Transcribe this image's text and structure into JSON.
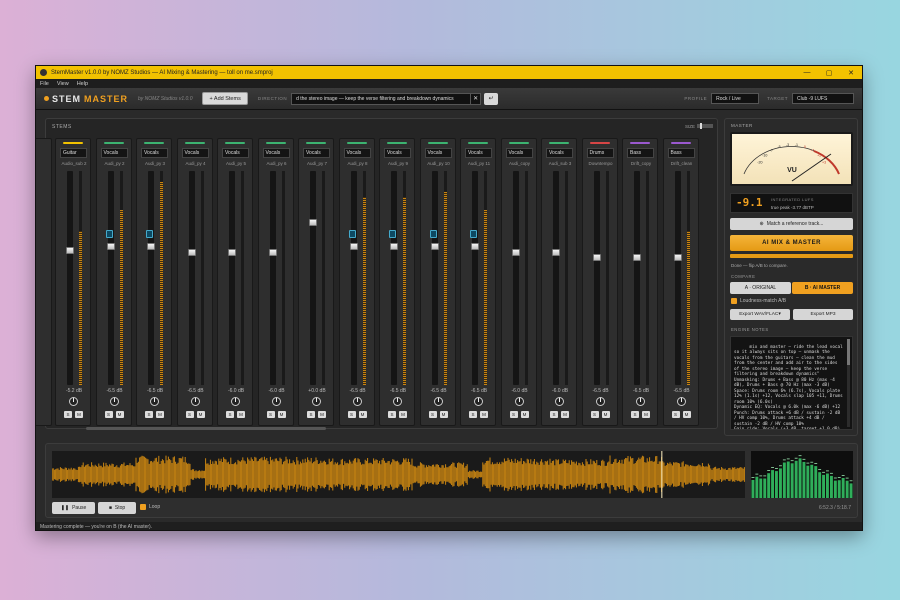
{
  "window": {
    "title": "StemMaster v1.0.0 by NOMZ Studios — AI Mixing & Mastering — toll on me.smproj",
    "controls": {
      "minimize": "—",
      "maximize": "▢",
      "close": "✕"
    }
  },
  "menu": [
    "File",
    "View",
    "Help"
  ],
  "toolbar": {
    "logo_main": "STEM",
    "logo_accent": "MASTER",
    "byline": "by NOMZ Studios   v1.0.0",
    "add_stems": "+ Add Stems",
    "direction_label": "DIRECTION",
    "direction_value": "d the stereo image — keep the verse filtering and breakdown dynamics",
    "direction_clear": "✕",
    "direction_enter": "↵",
    "profile_label": "PROFILE",
    "profile_value": "Rock / Live",
    "target_label": "TARGET",
    "target_value": "Club -9 LUFS"
  },
  "stems": {
    "title": "STEMS",
    "size_label": "SIZE",
    "channels": [
      {
        "type": "Guitar",
        "name": "Audio_sub 2",
        "color": "#f2c200",
        "db": "-5.2 dB",
        "level": 0.72,
        "fader": 0.63,
        "auto": false
      },
      {
        "type": "Vocals",
        "name": "Audi_py 2",
        "color": "#3cb371",
        "db": "-6.5 dB",
        "level": 0.82,
        "fader": 0.65,
        "auto": true
      },
      {
        "type": "Vocals",
        "name": "Audi_py 3",
        "color": "#3cb371",
        "db": "-6.5 dB",
        "level": 0.95,
        "fader": 0.65,
        "auto": true
      },
      {
        "type": "Vocals",
        "name": "Audi_py 4",
        "color": "#3cb371",
        "db": "-6.5 dB",
        "level": 0.0,
        "fader": 0.62,
        "auto": false
      },
      {
        "type": "Vocals",
        "name": "Audi_py 5",
        "color": "#3cb371",
        "db": "-6.0 dB",
        "level": 0.0,
        "fader": 0.62,
        "auto": false
      },
      {
        "type": "Vocals",
        "name": "Audi_py 6",
        "color": "#3cb371",
        "db": "-6.0 dB",
        "level": 0.0,
        "fader": 0.62,
        "auto": false
      },
      {
        "type": "Vocals",
        "name": "Audi_py 7",
        "color": "#3cb371",
        "db": "+0.0 dB",
        "level": 0.0,
        "fader": 0.76,
        "auto": false
      },
      {
        "type": "Vocals",
        "name": "Audi_py 8",
        "color": "#3cb371",
        "db": "-6.5 dB",
        "level": 0.88,
        "fader": 0.65,
        "auto": true
      },
      {
        "type": "Vocals",
        "name": "Audi_py 9",
        "color": "#3cb371",
        "db": "-6.5 dB",
        "level": 0.88,
        "fader": 0.65,
        "auto": true
      },
      {
        "type": "Vocals",
        "name": "Audi_py 10",
        "color": "#3cb371",
        "db": "-6.5 dB",
        "level": 0.9,
        "fader": 0.65,
        "auto": true
      },
      {
        "type": "Vocals",
        "name": "Audi_py 11",
        "color": "#3cb371",
        "db": "-6.5 dB",
        "level": 0.82,
        "fader": 0.65,
        "auto": true
      },
      {
        "type": "Vocals",
        "name": "Audi_copy",
        "color": "#3cb371",
        "db": "-6.0 dB",
        "level": 0.0,
        "fader": 0.62,
        "auto": false
      },
      {
        "type": "Vocals",
        "name": "Audi_sub 3",
        "color": "#3cb371",
        "db": "-6.0 dB",
        "level": 0.0,
        "fader": 0.62,
        "auto": false
      },
      {
        "type": "Drums",
        "name": "Downtempo",
        "color": "#d64545",
        "db": "-6.5 dB",
        "level": 0.0,
        "fader": 0.6,
        "auto": false
      },
      {
        "type": "Bass",
        "name": "Drift_copy",
        "color": "#9b59d0",
        "db": "-6.5 dB",
        "level": 0.0,
        "fader": 0.6,
        "auto": false
      },
      {
        "type": "Bass",
        "name": "Drift_clean",
        "color": "#9b59d0",
        "db": "-6.5 dB",
        "level": 0.72,
        "fader": 0.6,
        "auto": false
      }
    ],
    "solo_label": "S",
    "mute_label": "M"
  },
  "master": {
    "title": "MASTER",
    "vu_label": "VU",
    "vu_scale": [
      "-20",
      "-10",
      "-7",
      "-5",
      "-3",
      "-1",
      "0",
      "+1",
      "+2",
      "+3"
    ],
    "lufs_value": "-9.1",
    "lufs_label": "INTEGRATED LUFS",
    "lufs_sub": "true peak -3.77 dBTP",
    "match_ref": "Match a reference track...",
    "ai_button": "AI  MIX & MASTER",
    "progress": 1.0,
    "status": "Done — flip A/B to compare.",
    "compare_label": "COMPARE",
    "a_label": "A · ORIGINAL",
    "b_label": "B · AI MASTER",
    "loudness_label": "Loudness-match A/B",
    "export_wav": "Export WAV/FLAC",
    "export_wav_caret": "▾",
    "export_mp3": "Export MP3",
    "notes_label": "ENGINE NOTES",
    "notes": "mix and master — ride the lead vocal so it always sits on top — unmask the vocals from the guitars — clean the mud from the center and add air to the sides of the stereo image — keep the verse filtering and breakdown dynamics\"\nUnmasking: Drums + Bass @ 80 Hz (max -4 dB), Drums + Bass @ 70 Hz (max -3 dB)\nSpace: Drums room 6% (6.7s), Vocals plate 12% (1.1s) +12, Vocals slap 105 +11, Drums room 10% (6.0s)\nDynamic EQ: Vocals @ 6.0k (max -6 dB) +12\nPunch: Drums attack +6 dB / sustain -2 dB / HV comp 10%, Drums attack +4 dB / sustain -2 dB / HV comp 10%\nGain ride: Vocals (±3 dB, target +1.0 dB)",
    "colors": {
      "accent": "#f0a020"
    }
  },
  "transport": {
    "pause": "Pause",
    "stop": "Stop",
    "loop": "Loop",
    "time": "6:52.3 / 5:18.7",
    "playhead": 0.88
  },
  "statusbar": "Mastering complete — you're on B (the AI master)."
}
